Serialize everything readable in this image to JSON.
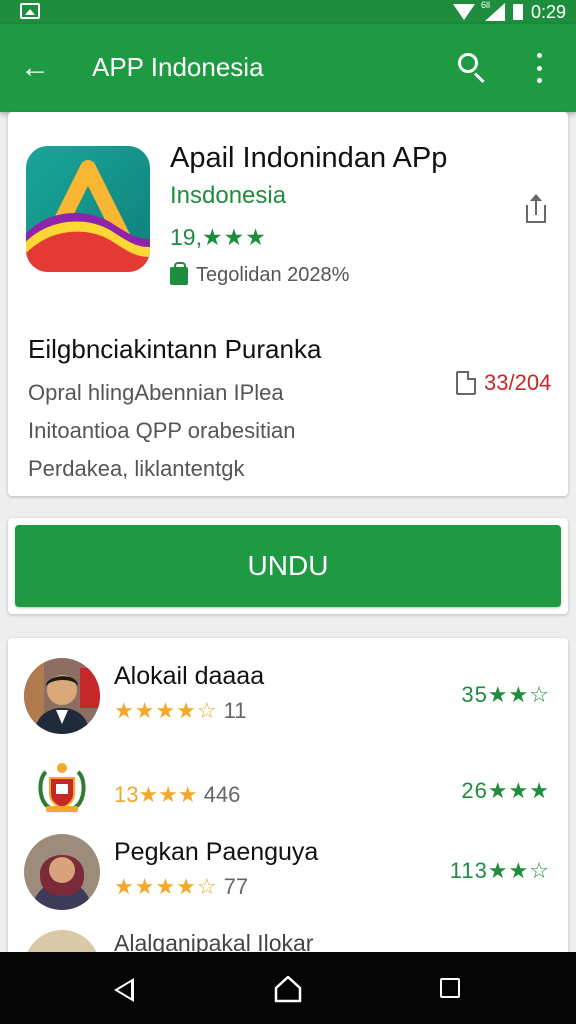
{
  "status_bar": {
    "time": "0:29",
    "signal_label": "6ll"
  },
  "app_bar": {
    "title": "APP Indonesia"
  },
  "app": {
    "name": "Apail Indonindan APp",
    "developer": "Insdonesia",
    "rating": "19,",
    "rating_stars": "★★★",
    "meta": "Tegolidan 2028%"
  },
  "description": {
    "title": "Eilgbnciakintann Puranka",
    "lines": [
      "Opral hlingAbennian IPlea",
      "Initoantioa QPP orabesitian",
      "Perdakea, liklantentgk"
    ],
    "size": "33/204"
  },
  "install": {
    "label": "UNDU"
  },
  "reviews": [
    {
      "name": "Alokail daaaa",
      "stars": "★★★★☆",
      "count": "11",
      "right_score": "35",
      "right_stars": "★★☆"
    },
    {
      "inline_score": "13★★★",
      "count": "446",
      "right_score": "26",
      "right_stars": "★★★"
    },
    {
      "name": "Pegkan Paenguya",
      "stars": "★★★★☆",
      "count": "77",
      "right_score": "113",
      "right_stars": "★★☆"
    },
    {
      "name": "Alalganipakal Ilokar"
    }
  ],
  "colors": {
    "primary": "#1e9a43",
    "status_bar": "#1e8e3e",
    "star": "#f2a92a",
    "size_text": "#c62828"
  }
}
